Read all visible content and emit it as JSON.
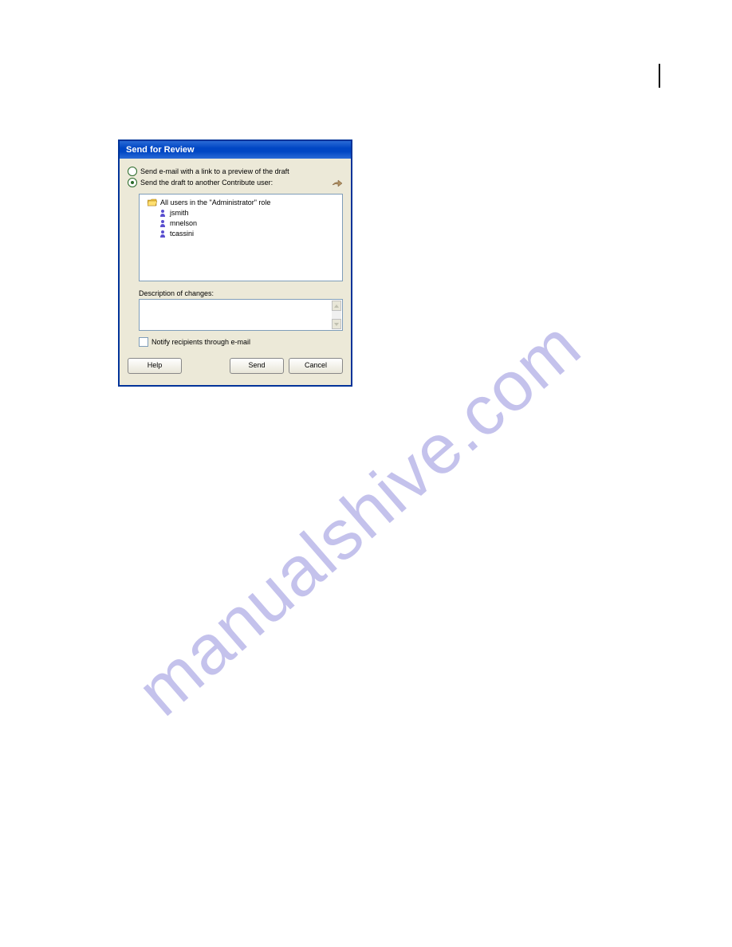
{
  "dialog": {
    "title": "Send for Review",
    "radio1_label": "Send e-mail with a link to a preview of the draft",
    "radio2_label": "Send the draft to another Contribute user:",
    "users": {
      "group_label": "All users in the \"Administrator\" role",
      "items": [
        "jsmith",
        "mnelson",
        "tcassini"
      ]
    },
    "description_label": "Description of changes:",
    "notify_label": "Notify recipients through e-mail",
    "buttons": {
      "help": "Help",
      "send": "Send",
      "cancel": "Cancel"
    }
  },
  "watermark": "manualshive.com"
}
